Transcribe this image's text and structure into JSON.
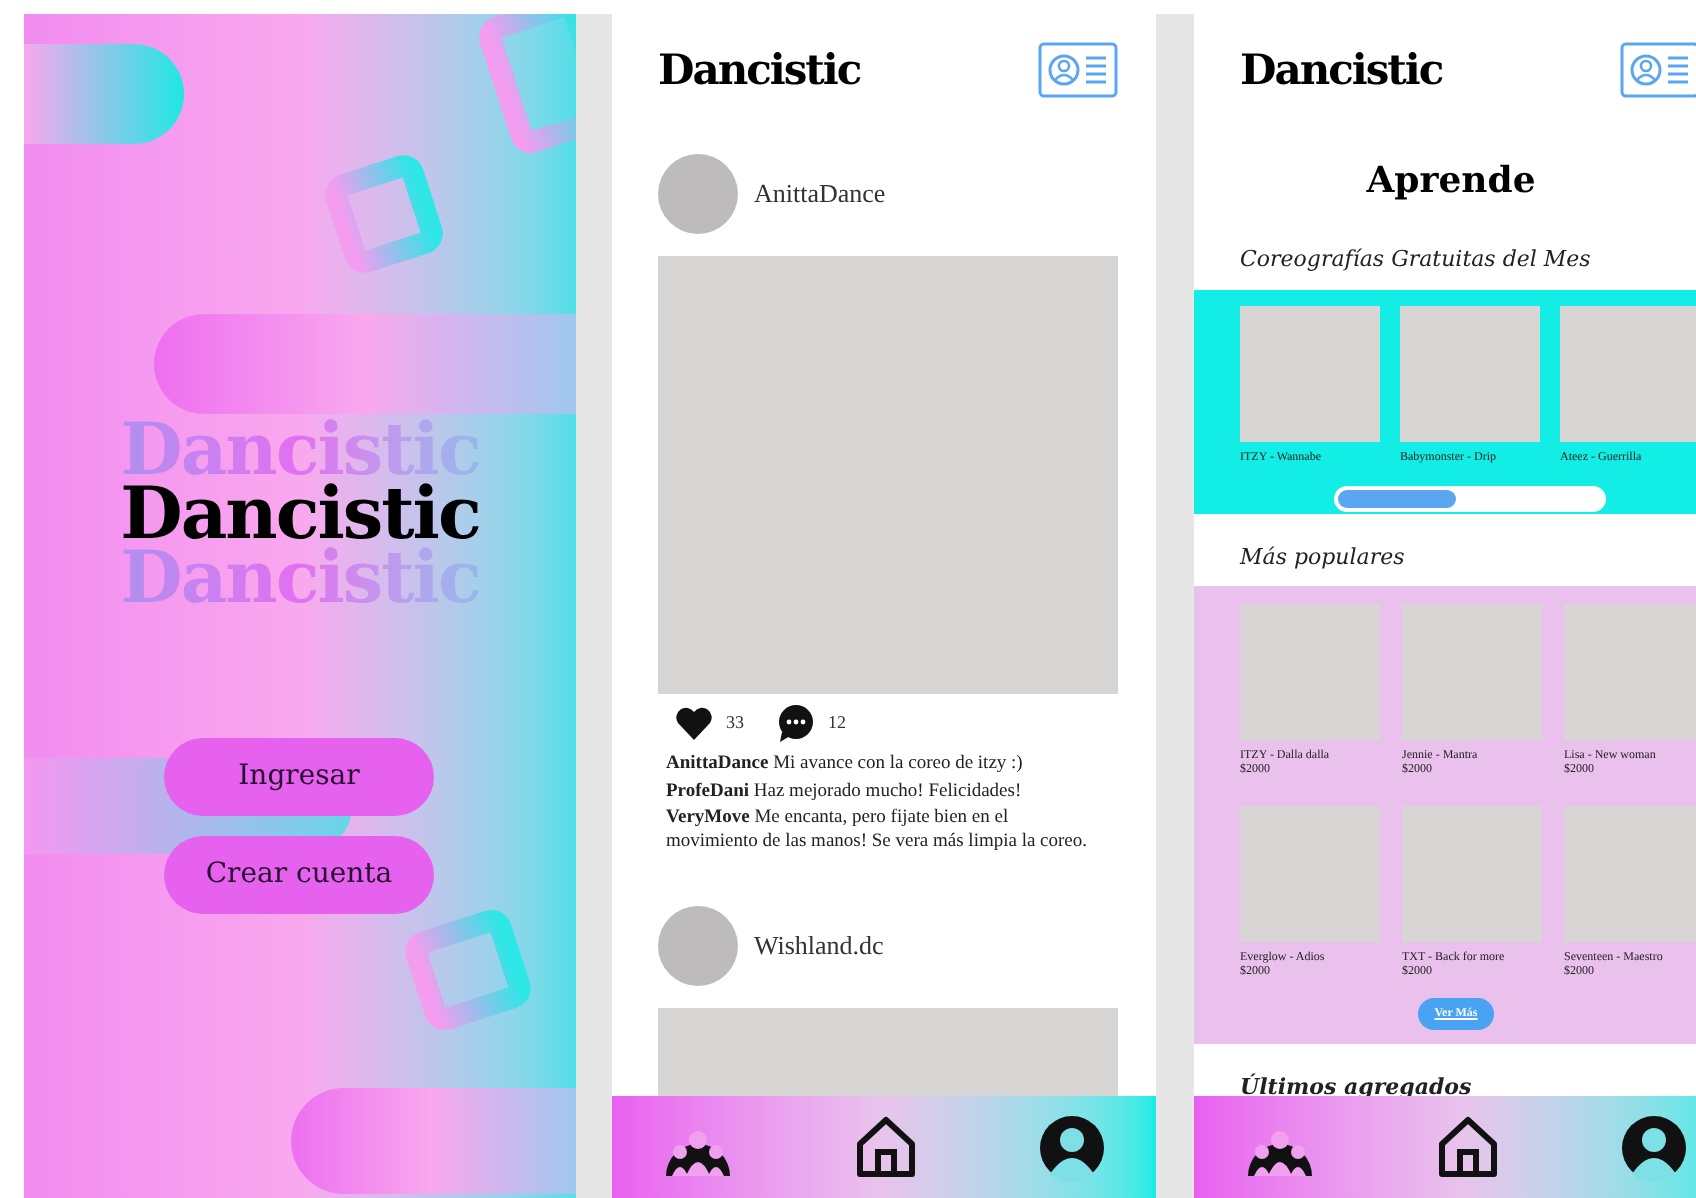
{
  "welcome": {
    "logo": "Dancistic",
    "logo_echoes": [
      "Dancistic",
      "Dancistic"
    ],
    "buttons": [
      "Ingresar",
      "Crear cuenta"
    ]
  },
  "feed": {
    "logo": "Dancistic",
    "posts": [
      {
        "user": "AnittaDance",
        "likes": "33",
        "comment_count": "12",
        "comments": [
          {
            "user": "AnittaDance",
            "text": "Mi avance con la coreo de itzy :)"
          },
          {
            "user": "ProfeDani",
            "text": "Haz mejorado mucho! Felicidades!"
          },
          {
            "user": "VeryMove",
            "text": "Me encanta, pero fijate bien en el movimiento de las manos! Se vera más limpia la coreo."
          }
        ]
      },
      {
        "user": "Wishland.dc"
      }
    ]
  },
  "learn": {
    "logo": "Dancistic",
    "title": "Aprende",
    "sections": [
      {
        "kind": "carousel",
        "title": "Coreografías Gratuitas del Mes",
        "level": 0.45,
        "items": [
          {
            "caption": "ITZY - Wannabe"
          },
          {
            "caption": "Babymonster - Drip"
          },
          {
            "caption": "Ateez - Guerrilla"
          }
        ]
      },
      {
        "kind": "grid",
        "title": "Más populares",
        "button": "Ver Más",
        "items": [
          {
            "caption": "ITZY - Dalla dalla",
            "price": "$2000"
          },
          {
            "caption": "Jennie - Mantra",
            "price": "$2000"
          },
          {
            "caption": "Lisa - New woman",
            "price": "$2000"
          },
          {
            "caption": "Everglow - Adios",
            "price": "$2000"
          },
          {
            "caption": "TXT - Back for more",
            "price": "$2000"
          },
          {
            "caption": "Seventeen - Maestro",
            "price": "$2000"
          }
        ]
      },
      {
        "kind": "heading",
        "title": "Últimos agregados"
      }
    ]
  }
}
